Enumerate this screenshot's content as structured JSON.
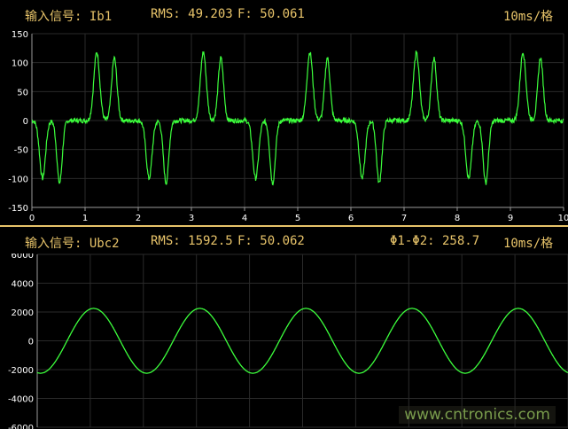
{
  "colors": {
    "header_text": "#e8c46a",
    "trace": "#3cff3c",
    "grid": "#2a2a2a",
    "axis": "#9a9a9a",
    "tick_text": "#ffffff",
    "background": "#000000"
  },
  "top_panel": {
    "signal_label": "输入信号: Ib1",
    "rms": "RMS: 49.203",
    "freq": "F: 50.061",
    "timebase": "10ms/格"
  },
  "bottom_panel": {
    "signal_label": "输入信号: Ubc2",
    "rms": "RMS: 1592.5",
    "freq": "F: 50.062",
    "phase": "Φ1-Φ2: 258.7",
    "timebase": "10ms/格"
  },
  "watermark": "www.cntronics.com",
  "chart_data": [
    {
      "type": "line",
      "series": [
        {
          "values_note": "current pulses",
          "peak_pos": 120,
          "peak_neg": -110
        }
      ],
      "x_ticks": [
        0,
        1,
        2,
        3,
        4,
        5,
        6,
        7,
        8,
        9,
        10
      ],
      "y_ticks": [
        150,
        100,
        50,
        0,
        -50,
        -100,
        -150
      ],
      "xlim": [
        0,
        10
      ],
      "ylim": [
        -150,
        150
      ],
      "grid": true,
      "signal_frequency_hz": 50.061
    },
    {
      "type": "line",
      "y_ticks": [
        6000,
        4000,
        2000,
        0,
        -2000,
        -4000,
        -6000
      ],
      "xlim": [
        0,
        10
      ],
      "ylim": [
        -6000,
        6000
      ],
      "grid": true,
      "amplitude": 2250,
      "phase_at_x0_deg": 258.7,
      "signal_frequency_hz": 50.062
    }
  ]
}
